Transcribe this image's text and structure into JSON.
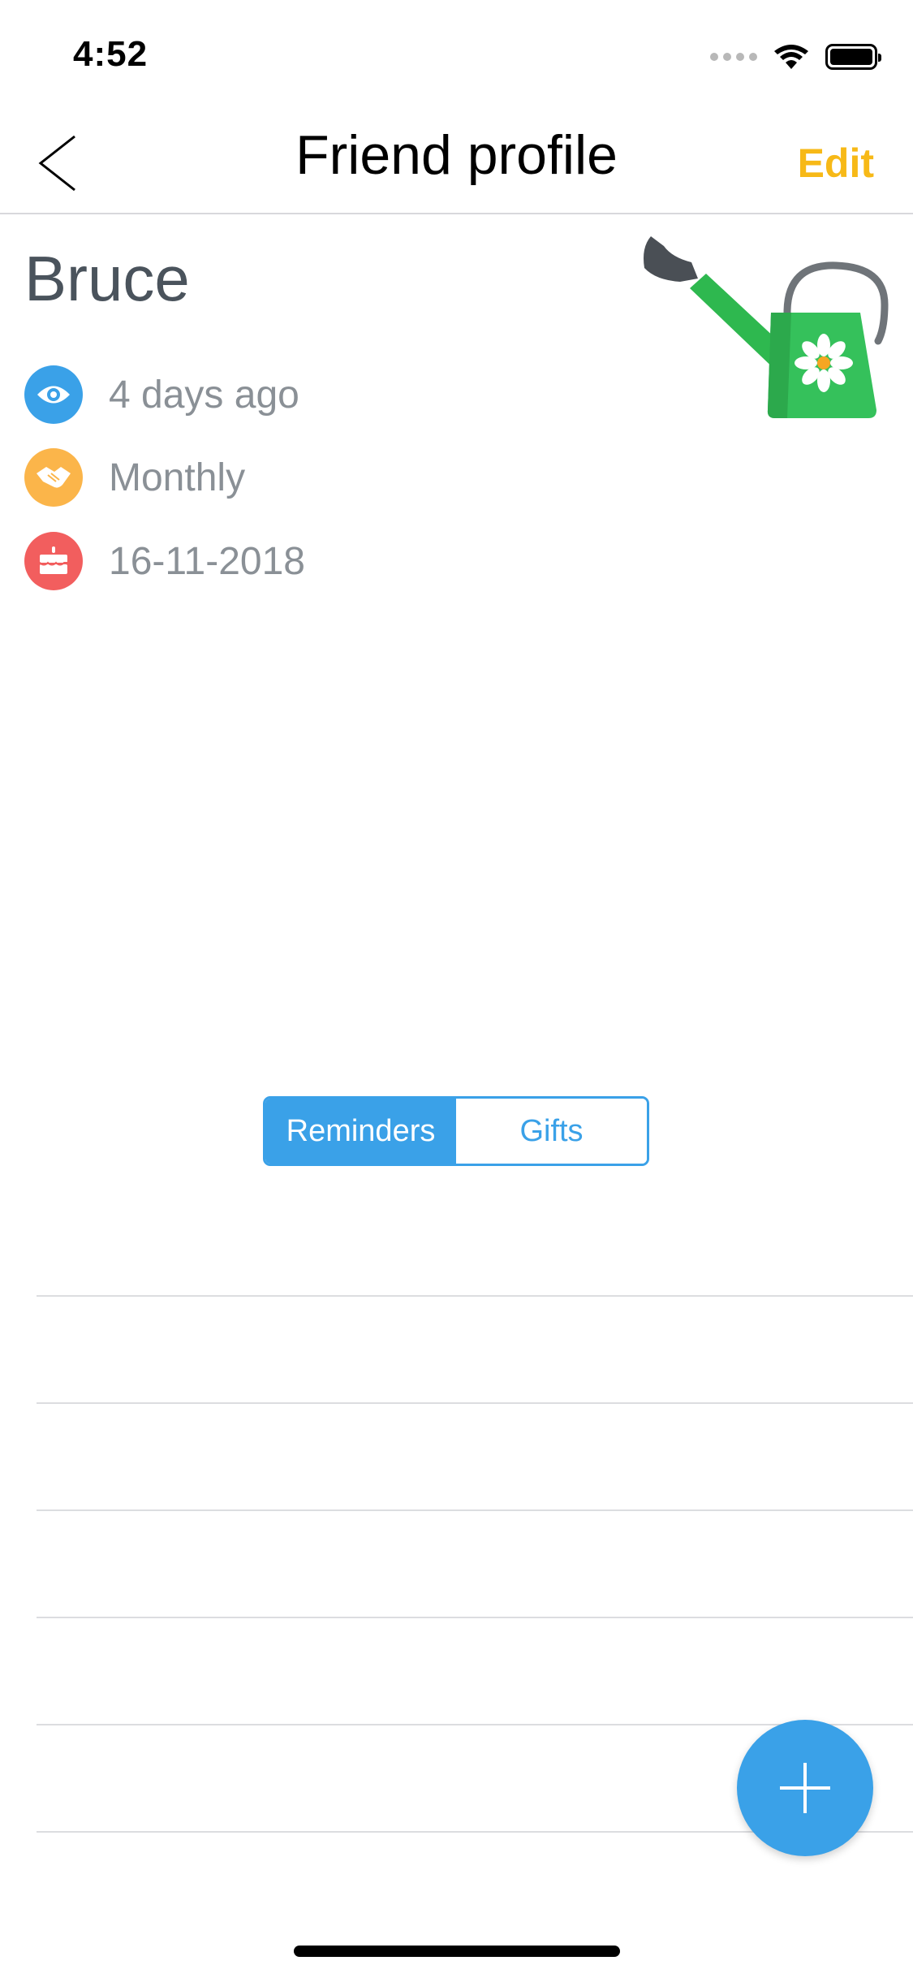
{
  "status_bar": {
    "time": "4:52"
  },
  "nav": {
    "title": "Friend profile",
    "edit_label": "Edit"
  },
  "profile": {
    "name": "Bruce",
    "avatar_icon": "watering-can-icon",
    "info": [
      {
        "icon": "eye-icon",
        "color": "#3aa1e8",
        "text": "4 days ago"
      },
      {
        "icon": "handshake-icon",
        "color": "#fbb54a",
        "text": "Monthly"
      },
      {
        "icon": "cake-icon",
        "color": "#f25e5e",
        "text": "16-11-2018"
      }
    ]
  },
  "tabs": {
    "reminders_label": "Reminders",
    "gifts_label": "Gifts",
    "selected": "Reminders"
  },
  "colors": {
    "accent": "#3aa1e8",
    "edit": "#f7b917"
  },
  "fab": {
    "icon": "plus-icon"
  }
}
